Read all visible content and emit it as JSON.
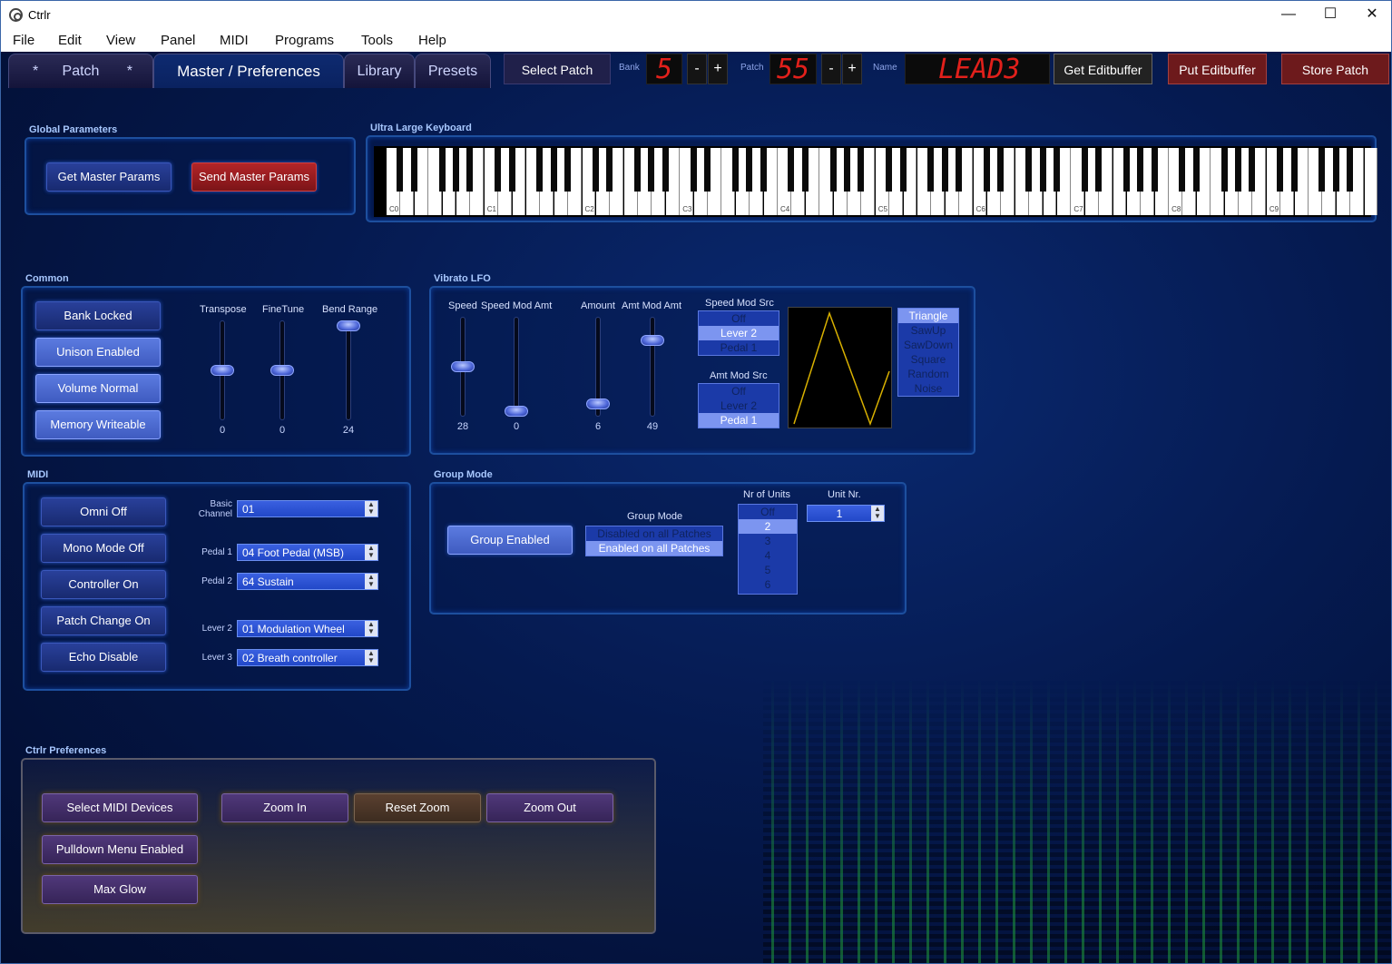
{
  "window": {
    "title": "Ctrlr",
    "minimize": "—",
    "maximize": "☐",
    "close": "✕"
  },
  "menu": [
    "File",
    "Edit",
    "View",
    "Panel",
    "MIDI",
    "Programs",
    "Tools",
    "Help"
  ],
  "tabs": {
    "patch": "Patch",
    "star1": "*",
    "star2": "*",
    "master": "Master / Preferences",
    "library": "Library",
    "presets": "Presets"
  },
  "toolbar": {
    "select_patch": "Select Patch",
    "bank_label": "Bank",
    "bank_value": "5",
    "patch_label": "Patch",
    "patch_value": "55",
    "name_label": "Name",
    "name_value": "LEAD3",
    "minus": "-",
    "plus": "+",
    "get_editbuffer": "Get Editbuffer",
    "put_editbuffer": "Put Editbuffer",
    "store_patch": "Store Patch"
  },
  "global": {
    "title": "Global Parameters",
    "get": "Get Master Params",
    "send": "Send Master Params"
  },
  "keyboard": {
    "title": "Ultra Large Keyboard",
    "octaves": [
      "C0",
      "C1",
      "C2",
      "C3",
      "C4",
      "C5",
      "C6",
      "C7",
      "C8",
      "C9"
    ]
  },
  "common": {
    "title": "Common",
    "buttons": [
      "Bank Locked",
      "Unison Enabled",
      "Volume Normal",
      "Memory Writeable"
    ],
    "sliders": [
      {
        "label": "Transpose",
        "value": "0",
        "level": 0.5
      },
      {
        "label": "FineTune",
        "value": "0",
        "level": 0.5
      },
      {
        "label": "Bend Range",
        "value": "24",
        "level": 1.0
      }
    ]
  },
  "vibrato": {
    "title": "Vibrato LFO",
    "sliders": [
      {
        "label": "Speed",
        "value": "28",
        "level": 0.5
      },
      {
        "label": "Speed Mod Amt",
        "value": "0",
        "level": 0.0
      },
      {
        "label": "Amount",
        "value": "6",
        "level": 0.08
      },
      {
        "label": "Amt Mod Amt",
        "value": "49",
        "level": 0.8
      }
    ],
    "speed_mod_src": {
      "label": "Speed Mod Src",
      "options": [
        "Off",
        "Lever 2",
        "Pedal 1"
      ],
      "selected": "Lever 2"
    },
    "amt_mod_src": {
      "label": "Amt Mod Src",
      "options": [
        "Off",
        "Lever 2",
        "Pedal 1"
      ],
      "selected": "Pedal 1"
    },
    "waves": {
      "options": [
        "Triangle",
        "SawUp",
        "SawDown",
        "Square",
        "Random",
        "Noise"
      ],
      "selected": "Triangle"
    },
    "wave_color": "#d9b100"
  },
  "midi": {
    "title": "MIDI",
    "buttons": [
      "Omni Off",
      "Mono Mode Off",
      "Controller On",
      "Patch Change On",
      "Echo Disable"
    ],
    "combos": [
      {
        "label": "Basic Channel",
        "value": "01"
      },
      {
        "label": "Pedal 1",
        "value": "04 Foot Pedal (MSB)"
      },
      {
        "label": "Pedal 2",
        "value": "64 Sustain"
      },
      {
        "label": "Lever 2",
        "value": "01 Modulation Wheel"
      },
      {
        "label": "Lever 3",
        "value": "02 Breath controller"
      }
    ]
  },
  "group": {
    "title": "Group Mode",
    "enabled": "Group Enabled",
    "mode_label": "Group Mode",
    "modes": [
      "Disabled on all Patches",
      "Enabled on all Patches"
    ],
    "mode_selected": "Enabled on all Patches",
    "units_label": "Nr of Units",
    "units": [
      "Off",
      "2",
      "3",
      "4",
      "5",
      "6"
    ],
    "units_selected": "2",
    "unit_nr_label": "Unit Nr.",
    "unit_nr": "1"
  },
  "prefs": {
    "title": "Ctrlr Preferences",
    "select_midi": "Select MIDI Devices",
    "pulldown": "Pulldown Menu Enabled",
    "max_glow": "Max Glow",
    "zoom_in": "Zoom In",
    "reset_zoom": "Reset Zoom",
    "zoom_out": "Zoom Out"
  },
  "colors": {
    "accent": "#1d4f9e",
    "lcd": "#e2201b",
    "matrix": "#28c83c"
  }
}
